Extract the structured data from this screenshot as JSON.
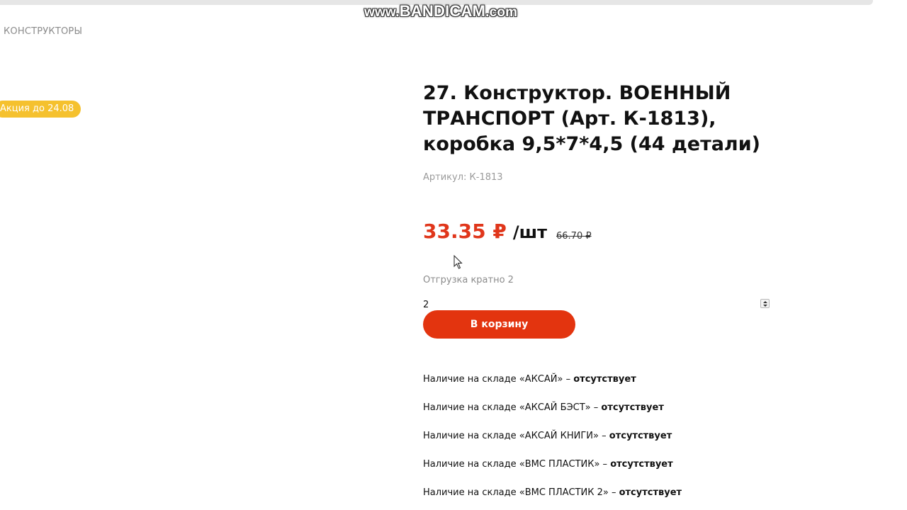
{
  "watermark": {
    "text_prefix": "www.",
    "text_brand": "BANDICAM",
    "text_suffix": ".com"
  },
  "breadcrumb": {
    "label": "КОНСТРУКТОРЫ"
  },
  "product": {
    "promo_badge": "Акция до 24.08",
    "title": "27. Конструктор. ВОЕННЫЙ ТРАНСПОРТ (Арт. К-1813), коробка 9,5*7*4,5 (44 детали)",
    "sku": "Артикул: К-1813",
    "price_current": "33.35 ₽",
    "price_unit": "/шт",
    "price_old": "66.70 ₽",
    "shipment_note": "Отгрузка кратно 2",
    "quantity": "2",
    "cart_button_label": "В корзину"
  },
  "stock": {
    "items": [
      {
        "label": "Наличие на складе «АКСАЙ» – ",
        "status": "отсутствует"
      },
      {
        "label": "Наличие на складе «АКСАЙ БЭСТ» – ",
        "status": "отсутствует"
      },
      {
        "label": "Наличие на складе «АКСАЙ КНИГИ» – ",
        "status": "отсутствует"
      },
      {
        "label": "Наличие на складе «ВМС ПЛАСТИК» – ",
        "status": "отсутствует"
      },
      {
        "label": "Наличие на складе «ВМС ПЛАСТИК 2» – ",
        "status": "отсутствует"
      }
    ]
  },
  "colors": {
    "accent": "#e3340f",
    "price": "#e0361b",
    "promo": "#f5c12e"
  },
  "icons": {
    "cursor": "mouse-pointer-icon",
    "spinner": "number-spinner-icon"
  }
}
